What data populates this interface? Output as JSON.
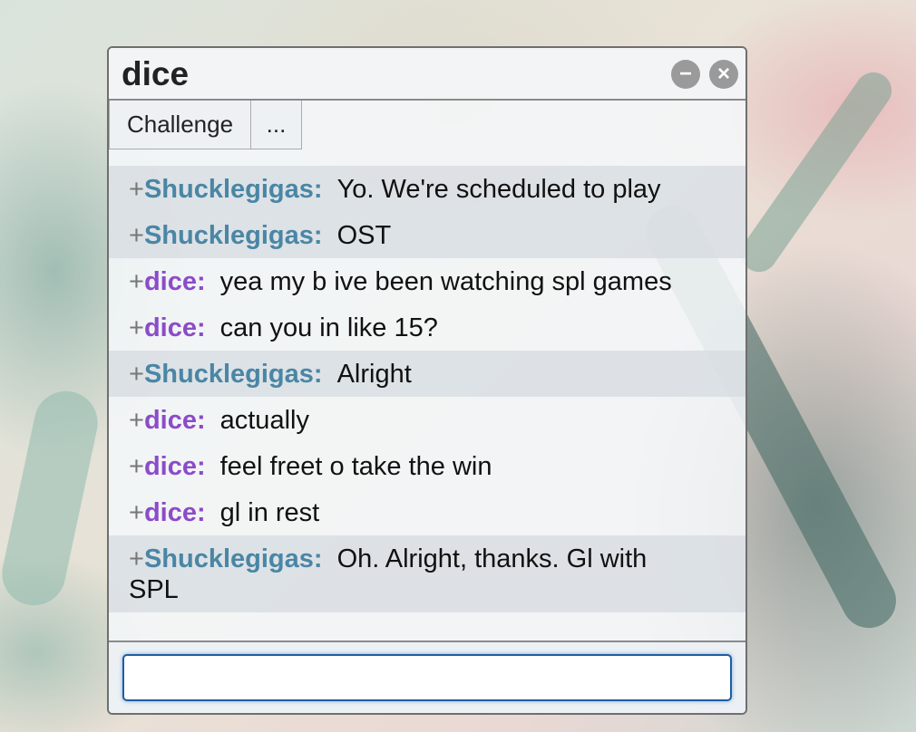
{
  "window": {
    "title": "dice",
    "minimize_label": "−",
    "close_label": "×"
  },
  "toolbar": {
    "challenge_label": "Challenge",
    "more_label": "..."
  },
  "messages": [
    {
      "prefix": "+",
      "user": "Shucklegigas:",
      "text": "Yo. We're scheduled to play"
    },
    {
      "prefix": "+",
      "user": "Shucklegigas:",
      "text": "OST"
    },
    {
      "prefix": "+",
      "user": "dice:",
      "text": "yea my b ive been watching spl games"
    },
    {
      "prefix": "+",
      "user": "dice:",
      "text": "can you in like 15?"
    },
    {
      "prefix": "+",
      "user": "Shucklegigas:",
      "text": "Alright"
    },
    {
      "prefix": "+",
      "user": "dice:",
      "text": "actually"
    },
    {
      "prefix": "+",
      "user": "dice:",
      "text": "feel freet o take the win"
    },
    {
      "prefix": "+",
      "user": "dice:",
      "text": "gl in rest"
    },
    {
      "prefix": "+",
      "user": "Shucklegigas:",
      "text": "Oh. Alright, thanks. Gl with SPL"
    }
  ],
  "chat_input": {
    "value": "",
    "placeholder": ""
  },
  "colors": {
    "shucklegigas": "#4a86a5",
    "dice": "#8c4bc9",
    "input_border": "#1f5da0"
  }
}
